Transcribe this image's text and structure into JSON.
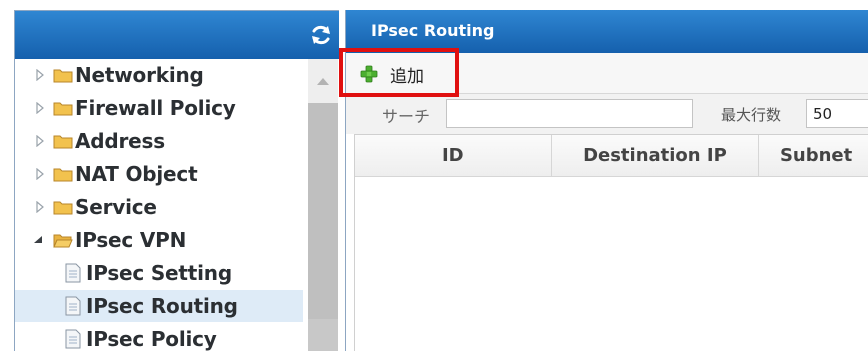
{
  "sidebar": {
    "items": [
      {
        "label": "Networking",
        "type": "folder",
        "expanded": false
      },
      {
        "label": "Firewall Policy",
        "type": "folder",
        "expanded": false
      },
      {
        "label": "Address",
        "type": "folder",
        "expanded": false
      },
      {
        "label": "NAT Object",
        "type": "folder",
        "expanded": false
      },
      {
        "label": "Service",
        "type": "folder",
        "expanded": false
      },
      {
        "label": "IPsec VPN",
        "type": "folder",
        "expanded": true
      },
      {
        "label": "IPsec Setting",
        "type": "page"
      },
      {
        "label": "IPsec Routing",
        "type": "page",
        "selected": true
      },
      {
        "label": "IPsec Policy",
        "type": "page"
      }
    ],
    "refresh_icon": "refresh-icon"
  },
  "main": {
    "title": "IPsec Routing",
    "toolbar": {
      "add_label": "追加",
      "add_icon": "plus-icon"
    },
    "search": {
      "label": "サーチ",
      "value": ""
    },
    "max_rows": {
      "label": "最大行数",
      "value": "50"
    },
    "table": {
      "columns": [
        "ID",
        "Destination IP",
        "Subnet"
      ],
      "rows": []
    }
  },
  "colors": {
    "header_blue": "#1f72c0",
    "highlight_red": "#e01010",
    "selected_row": "#deebf7",
    "folder_yellow": "#f2c24e",
    "plus_green": "#4caf30"
  }
}
